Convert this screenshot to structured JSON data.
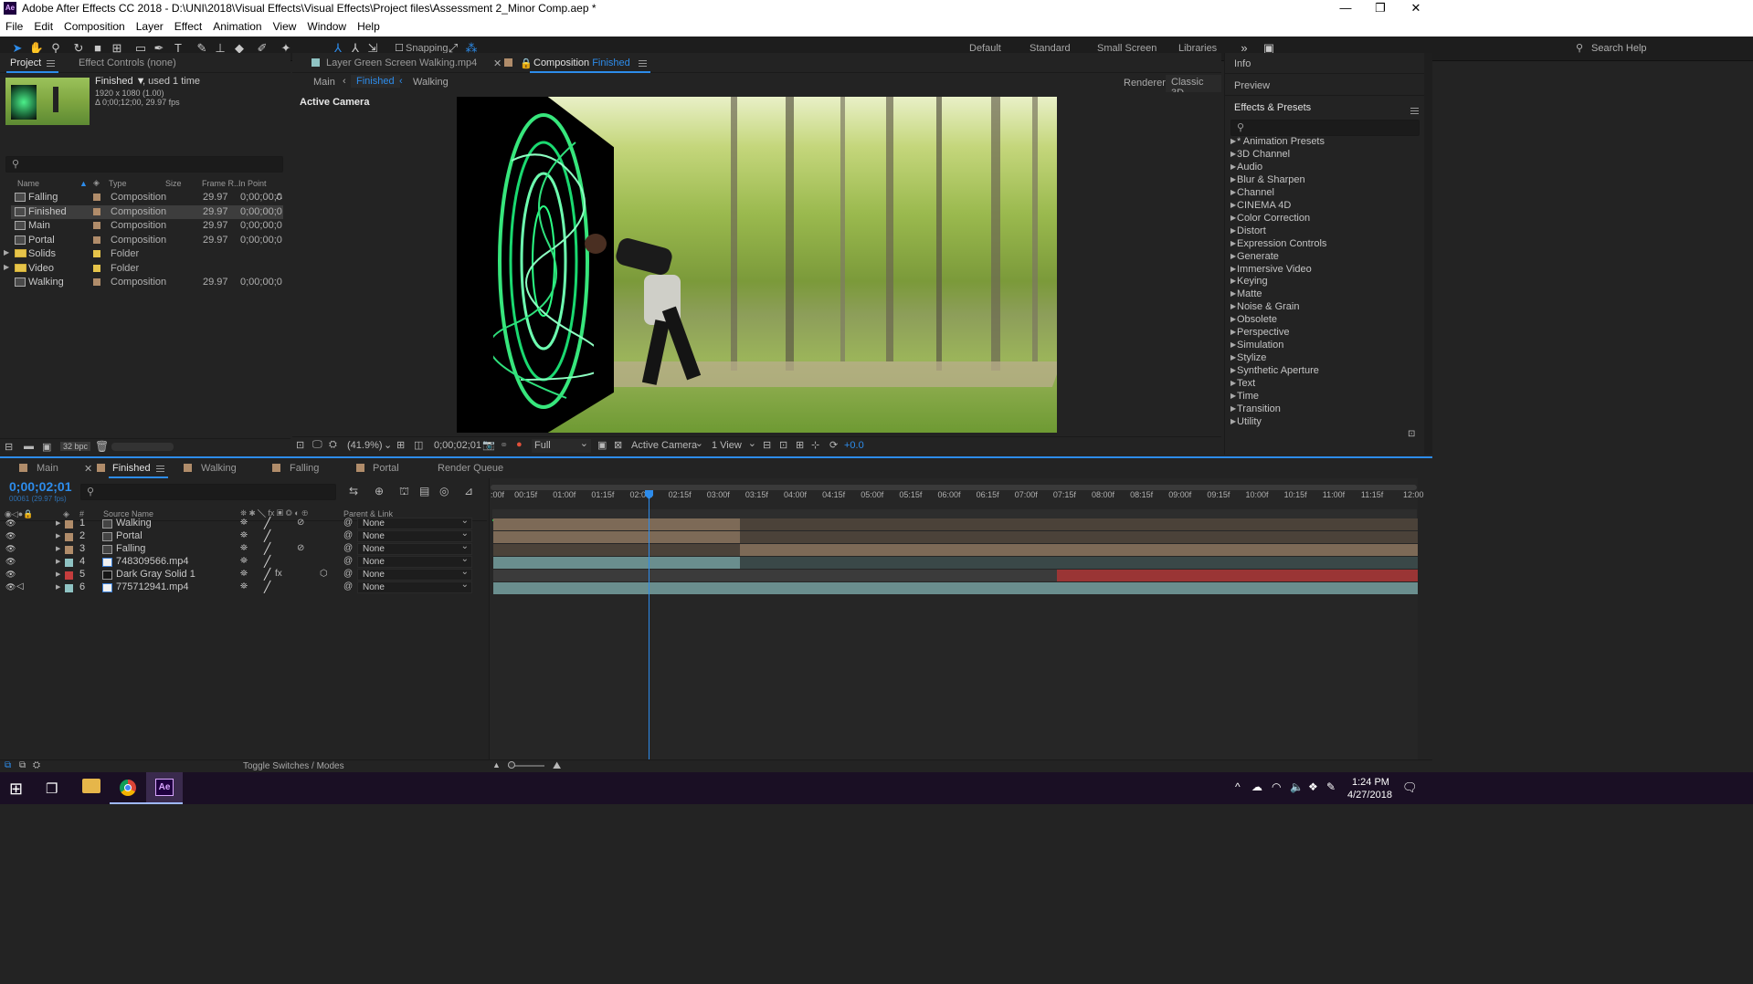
{
  "window": {
    "title": "Adobe After Effects CC 2018 - D:\\UNI\\2018\\Visual Effects\\Visual Effects\\Project files\\Assessment 2_Minor Comp.aep *",
    "app_icon_label": "Ae"
  },
  "menu": [
    "File",
    "Edit",
    "Composition",
    "Layer",
    "Effect",
    "Animation",
    "View",
    "Window",
    "Help"
  ],
  "toolbar": {
    "snapping_label": "Snapping",
    "workspaces": [
      "Default",
      "Standard",
      "Small Screen",
      "Libraries"
    ],
    "search_help": "Search Help"
  },
  "project_panel": {
    "tab_project": "Project",
    "tab_effect_controls": "Effect Controls (none)",
    "selected_name": "Finished ▼",
    "selected_used": ", used 1 time",
    "selected_dims": "1920 x 1080 (1.00)",
    "selected_duration": "Δ 0;00;12;00, 29.97 fps",
    "search_placeholder": "",
    "columns": {
      "name": "Name",
      "type": "Type",
      "size": "Size",
      "frame_rate": "Frame R...",
      "in_point": "In Point"
    },
    "items": [
      {
        "name": "Falling",
        "type": "Composition",
        "fps": "29.97",
        "in": "0;00;00;0",
        "color": "#b08c6a",
        "kind": "comp"
      },
      {
        "name": "Finished",
        "type": "Composition",
        "fps": "29.97",
        "in": "0;00;00;0",
        "color": "#b08c6a",
        "kind": "comp"
      },
      {
        "name": "Main",
        "type": "Composition",
        "fps": "29.97",
        "in": "0;00;00;0",
        "color": "#b08c6a",
        "kind": "comp"
      },
      {
        "name": "Portal",
        "type": "Composition",
        "fps": "29.97",
        "in": "0;00;00;0",
        "color": "#b08c6a",
        "kind": "comp"
      },
      {
        "name": "Solids",
        "type": "Folder",
        "fps": "",
        "in": "",
        "color": "#e6c44a",
        "kind": "folder"
      },
      {
        "name": "Video",
        "type": "Folder",
        "fps": "",
        "in": "",
        "color": "#e6c44a",
        "kind": "folder"
      },
      {
        "name": "Walking",
        "type": "Composition",
        "fps": "29.97",
        "in": "0;00;00;0",
        "color": "#b08c6a",
        "kind": "comp"
      }
    ],
    "bpc": "32 bpc"
  },
  "viewer": {
    "tab_layer": "Layer  Green Screen Walking.mp4",
    "tab_comp_prefix": "Composition",
    "tab_comp_name": "Finished",
    "nav": [
      "Main",
      "Finished",
      "Walking"
    ],
    "renderer_label": "Renderer:",
    "renderer_value": "Classic 3D",
    "active_camera": "Active Camera",
    "zoom": "(41.9%)",
    "timecode": "0;00;02;01",
    "resolution": "Full",
    "camera_select": "Active Camera",
    "view_select": "1 View",
    "exposure": "+0.0"
  },
  "right_panel": {
    "info": "Info",
    "preview": "Preview",
    "effects_presets": "Effects & Presets",
    "effects": [
      "* Animation Presets",
      "3D Channel",
      "Audio",
      "Blur & Sharpen",
      "Channel",
      "CINEMA 4D",
      "Color Correction",
      "Distort",
      "Expression Controls",
      "Generate",
      "Immersive Video",
      "Keying",
      "Matte",
      "Noise & Grain",
      "Obsolete",
      "Perspective",
      "Simulation",
      "Stylize",
      "Synthetic Aperture",
      "Text",
      "Time",
      "Transition",
      "Utility"
    ]
  },
  "timeline": {
    "tabs": [
      "Main",
      "Finished",
      "Walking",
      "Falling",
      "Portal",
      "Render Queue"
    ],
    "timecode": "0;00;02;01",
    "timecode_sub": "00061 (29.97 fps)",
    "col_source_name": "Source Name",
    "col_parent": "Parent & Link",
    "ruler": [
      ":00f",
      "00:15f",
      "01:00f",
      "01:15f",
      "02:00f",
      "02:15f",
      "03:00f",
      "03:15f",
      "04:00f",
      "04:15f",
      "05:00f",
      "05:15f",
      "06:00f",
      "06:15f",
      "07:00f",
      "07:15f",
      "08:00f",
      "08:15f",
      "09:00f",
      "09:15f",
      "10:00f",
      "10:15f",
      "11:00f",
      "11:15f",
      "12:00"
    ],
    "layers": [
      {
        "num": "1",
        "name": "Walking",
        "parent": "None",
        "color": "#b08c6a"
      },
      {
        "num": "2",
        "name": "Portal",
        "parent": "None",
        "color": "#b08c6a"
      },
      {
        "num": "3",
        "name": "Falling",
        "parent": "None",
        "color": "#b08c6a"
      },
      {
        "num": "4",
        "name": "748309566.mp4",
        "parent": "None",
        "color": "#8fc3c3"
      },
      {
        "num": "5",
        "name": "Dark Gray Solid 1",
        "parent": "None",
        "color": "#c43d3d"
      },
      {
        "num": "6",
        "name": "775712941.mp4",
        "parent": "None",
        "color": "#8fc3c3"
      }
    ],
    "toggle_label": "Toggle Switches / Modes"
  },
  "taskbar": {
    "time": "1:24 PM",
    "date": "4/27/2018",
    "ae_label": "Ae"
  }
}
